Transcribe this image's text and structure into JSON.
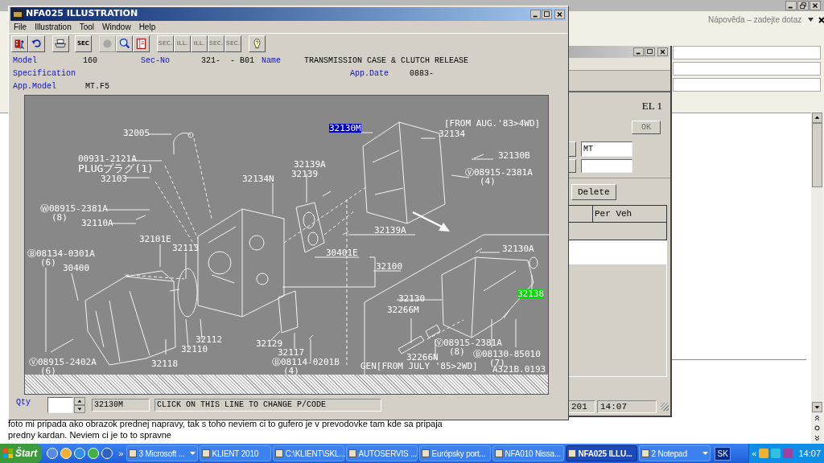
{
  "background_window": {
    "help_placeholder": "Nápověda – zadejte dotaz",
    "document_lines": [
      "foto mi pripada ako obrazok prednej napravy, tak s toho neviem ci to gufero je v prevodovke tam kde sa pripaja",
      "predny kardan. Neviem ci je to to spravne"
    ]
  },
  "parts_window": {
    "code": "EL 1",
    "ok_button": {
      "label": "OK",
      "disabled": true
    },
    "type_field": "MT",
    "delete_button": "Delete",
    "columns": [
      "Per Veh"
    ],
    "status": [
      "201",
      "14:07"
    ]
  },
  "illustration_window": {
    "title": "NFA025 ILLUSTRATION",
    "menu": [
      "File",
      "Illustration",
      "Tool",
      "Window",
      "Help"
    ],
    "toolbar": [
      {
        "kind": "icon",
        "disabled": false
      },
      {
        "kind": "icon",
        "disabled": false
      },
      {
        "kind": "icon",
        "disabled": false
      },
      {
        "kind": "text",
        "label": "SEC",
        "disabled": false
      },
      {
        "kind": "icon",
        "disabled": true
      },
      {
        "kind": "icon",
        "disabled": false
      },
      {
        "kind": "icon",
        "disabled": false
      },
      {
        "kind": "text",
        "label": "SEC.",
        "disabled": true
      },
      {
        "kind": "text",
        "label": "ILL.",
        "disabled": true
      },
      {
        "kind": "text",
        "label": "ILL.",
        "disabled": true
      },
      {
        "kind": "text",
        "label": "SEC.",
        "disabled": true
      },
      {
        "kind": "text",
        "label": "SEC.",
        "disabled": true
      },
      {
        "kind": "icon",
        "disabled": false
      }
    ],
    "info": [
      {
        "label": "Model",
        "value": "160"
      },
      {
        "label": "Sec-No",
        "value": "321-  - B01"
      },
      {
        "label": "Name",
        "value": "TRANSMISSION CASE & CLUTCH RELEASE"
      },
      {
        "label": "Specification"
      },
      {
        "label": "App.Date",
        "value": "0883-"
      },
      {
        "label": "App.Model",
        "value": "MT.F5"
      }
    ],
    "callouts": [
      {
        "text": "32005"
      },
      {
        "text": "00931-2121A"
      },
      {
        "text": "PLUGプラグ(1)"
      },
      {
        "text": "32103"
      },
      {
        "text": "Ⓦ08915-2381A"
      },
      {
        "text": "(8)"
      },
      {
        "text": "32110A"
      },
      {
        "text": "32101E"
      },
      {
        "text": "32113"
      },
      {
        "text": "Ⓑ08134-0301A"
      },
      {
        "text": "(6)"
      },
      {
        "text": "30400"
      },
      {
        "text": "32134N"
      },
      {
        "text": "32139A"
      },
      {
        "text": "32139"
      },
      {
        "text": "32139A"
      },
      {
        "text": "30401E"
      },
      {
        "text": "32100"
      },
      {
        "text": "32130M",
        "color": "#0000cc"
      },
      {
        "text": "[FROM AUG.'83>4WD]"
      },
      {
        "text": "32134"
      },
      {
        "text": "32130B"
      },
      {
        "text": "Ⓥ08915-2381A"
      },
      {
        "text": "(4)"
      },
      {
        "text": "32130A"
      },
      {
        "text": "32138",
        "color": "#00dd00"
      },
      {
        "text": "32130"
      },
      {
        "text": "32266M"
      },
      {
        "text": "Ⓥ08915-2381A"
      },
      {
        "text": "(8)"
      },
      {
        "text": "Ⓑ08130-85010"
      },
      {
        "text": "(7)"
      },
      {
        "text": "32266N"
      },
      {
        "text": "GEN[FROM JULY '85>2WD]"
      },
      {
        "text": "A321B.0193"
      },
      {
        "text": "32112"
      },
      {
        "text": "32110"
      },
      {
        "text": "Ⓥ08915-2402A"
      },
      {
        "text": "(6)"
      },
      {
        "text": "32118"
      },
      {
        "text": "32129"
      },
      {
        "text": "32117"
      },
      {
        "text": "Ⓑ08114-0201B"
      },
      {
        "text": "(4)"
      }
    ],
    "qty_label": "Qty",
    "part_code": "32130M",
    "message": "CLICK ON THIS LINE TO CHANGE P/CODE"
  },
  "taskbar": {
    "start": "Štart",
    "more": "»",
    "tasks": [
      {
        "label": "3 Microsoft ...",
        "menu": true,
        "selected": false
      },
      {
        "label": "KLIENT 2010",
        "menu": false,
        "selected": false
      },
      {
        "label": "C:\\KLIENT\\SKL...",
        "menu": false,
        "selected": false
      },
      {
        "label": "AUTOSERVIS ...",
        "menu": false,
        "selected": false
      },
      {
        "label": "Európsky port...",
        "menu": false,
        "selected": false
      },
      {
        "label": "NFA010 Nissa...",
        "menu": false,
        "selected": false
      },
      {
        "label": "NFA025 ILLU...",
        "menu": false,
        "selected": true
      },
      {
        "label": "2 Notepad",
        "menu": true,
        "selected": false
      }
    ],
    "language": "SK",
    "tray_expand": "«",
    "clock": "14:07"
  }
}
